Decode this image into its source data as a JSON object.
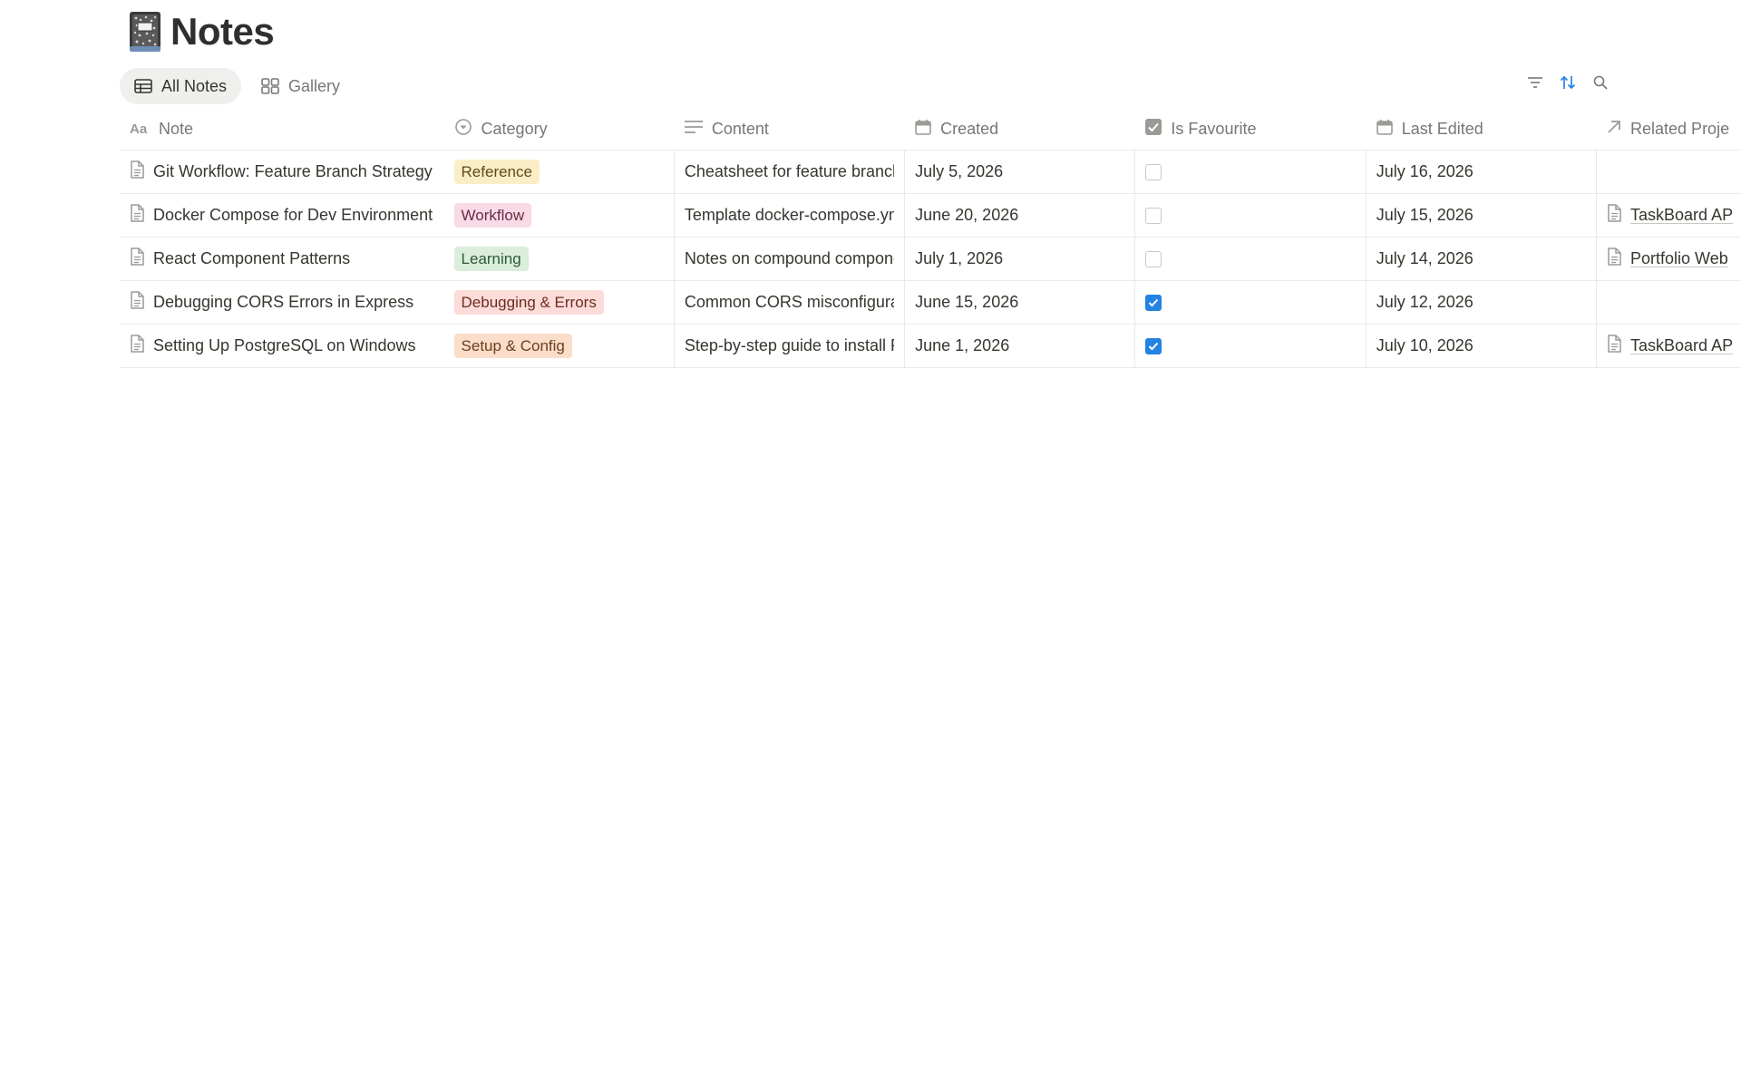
{
  "page": {
    "title": "Notes",
    "icon": "notebook-icon"
  },
  "views": [
    {
      "label": "All Notes",
      "icon": "table-icon",
      "active": true
    },
    {
      "label": "Gallery",
      "icon": "gallery-grid-icon",
      "active": false
    }
  ],
  "toolbar": {
    "icons": [
      "filter-icon",
      "sort-icon",
      "search-icon"
    ],
    "sort_color": "#2383e2"
  },
  "columns": [
    {
      "label": "Note",
      "icon": "title-aa-icon"
    },
    {
      "label": "Category",
      "icon": "select-circle-icon"
    },
    {
      "label": "Content",
      "icon": "text-lines-icon"
    },
    {
      "label": "Created",
      "icon": "calendar-icon"
    },
    {
      "label": "Is Favourite",
      "icon": "checkbox-icon"
    },
    {
      "label": "Last Edited",
      "icon": "calendar-icon"
    },
    {
      "label": "Related Proje",
      "icon": "relation-arrow-icon"
    }
  ],
  "rows": [
    {
      "note": "Git Workflow: Feature Branch Strategy",
      "category": "Reference",
      "category_color": "yellow",
      "content": "Cheatsheet for feature branch workflow",
      "created": "July 5, 2026",
      "favourite": false,
      "edited": "July 16, 2026",
      "related": ""
    },
    {
      "note": "Docker Compose for Dev Environments",
      "category": "Workflow",
      "category_color": "pink",
      "content": "Template docker-compose.yml",
      "created": "June 20, 2026",
      "favourite": false,
      "edited": "July 15, 2026",
      "related": "TaskBoard AP"
    },
    {
      "note": "React Component Patterns",
      "category": "Learning",
      "category_color": "green",
      "content": "Notes on compound components",
      "created": "July 1, 2026",
      "favourite": false,
      "edited": "July 14, 2026",
      "related": "Portfolio Web"
    },
    {
      "note": "Debugging CORS Errors in Express",
      "category": "Debugging & Errors",
      "category_color": "red",
      "content": "Common CORS misconfigurations",
      "created": "June 15, 2026",
      "favourite": true,
      "edited": "July 12, 2026",
      "related": ""
    },
    {
      "note": "Setting Up PostgreSQL on Windows",
      "category": "Setup & Config",
      "category_color": "orange",
      "content": "Step-by-step guide to install Postgres",
      "created": "June 1, 2026",
      "favourite": true,
      "edited": "July 10, 2026",
      "related": "TaskBoard AP"
    }
  ]
}
